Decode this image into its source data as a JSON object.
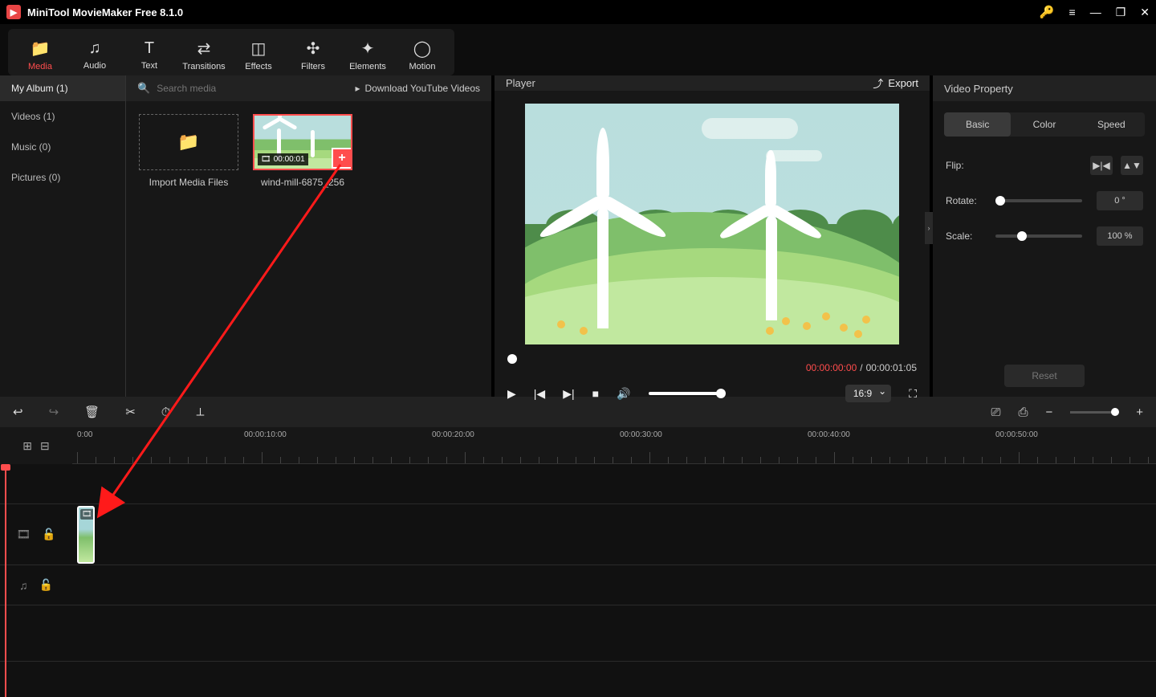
{
  "app": {
    "title": "MiniTool MovieMaker Free 8.1.0"
  },
  "category_tabs": [
    {
      "label": "Media",
      "icon": "📁",
      "active": true
    },
    {
      "label": "Audio",
      "icon": "♫"
    },
    {
      "label": "Text",
      "icon": "T"
    },
    {
      "label": "Transitions",
      "icon": "⇄"
    },
    {
      "label": "Effects",
      "icon": "◫"
    },
    {
      "label": "Filters",
      "icon": "✣"
    },
    {
      "label": "Elements",
      "icon": "✦"
    },
    {
      "label": "Motion",
      "icon": "◯"
    }
  ],
  "sidebar": {
    "header": "My Album (1)",
    "items": [
      "Videos (1)",
      "Music (0)",
      "Pictures (0)"
    ]
  },
  "media": {
    "search_placeholder": "Search media",
    "download_label": "Download YouTube Videos",
    "import_label": "Import Media Files",
    "clip_name": "wind-mill-6875_256",
    "clip_duration": "00:00:01"
  },
  "player": {
    "title": "Player",
    "export": "Export",
    "time_current": "00:00:00:00",
    "time_total": "00:00:01:05",
    "ratio": "16:9"
  },
  "property": {
    "title": "Video Property",
    "tabs": [
      "Basic",
      "Color",
      "Speed"
    ],
    "flip_label": "Flip:",
    "rotate_label": "Rotate:",
    "rotate_value": "0 °",
    "scale_label": "Scale:",
    "scale_value": "100 %",
    "reset": "Reset"
  },
  "timeline": {
    "ruler_start": "0:00",
    "ruler_marks": [
      "00:00:10:00",
      "00:00:20:00",
      "00:00:30:00",
      "00:00:40:00",
      "00:00:50:00"
    ]
  }
}
